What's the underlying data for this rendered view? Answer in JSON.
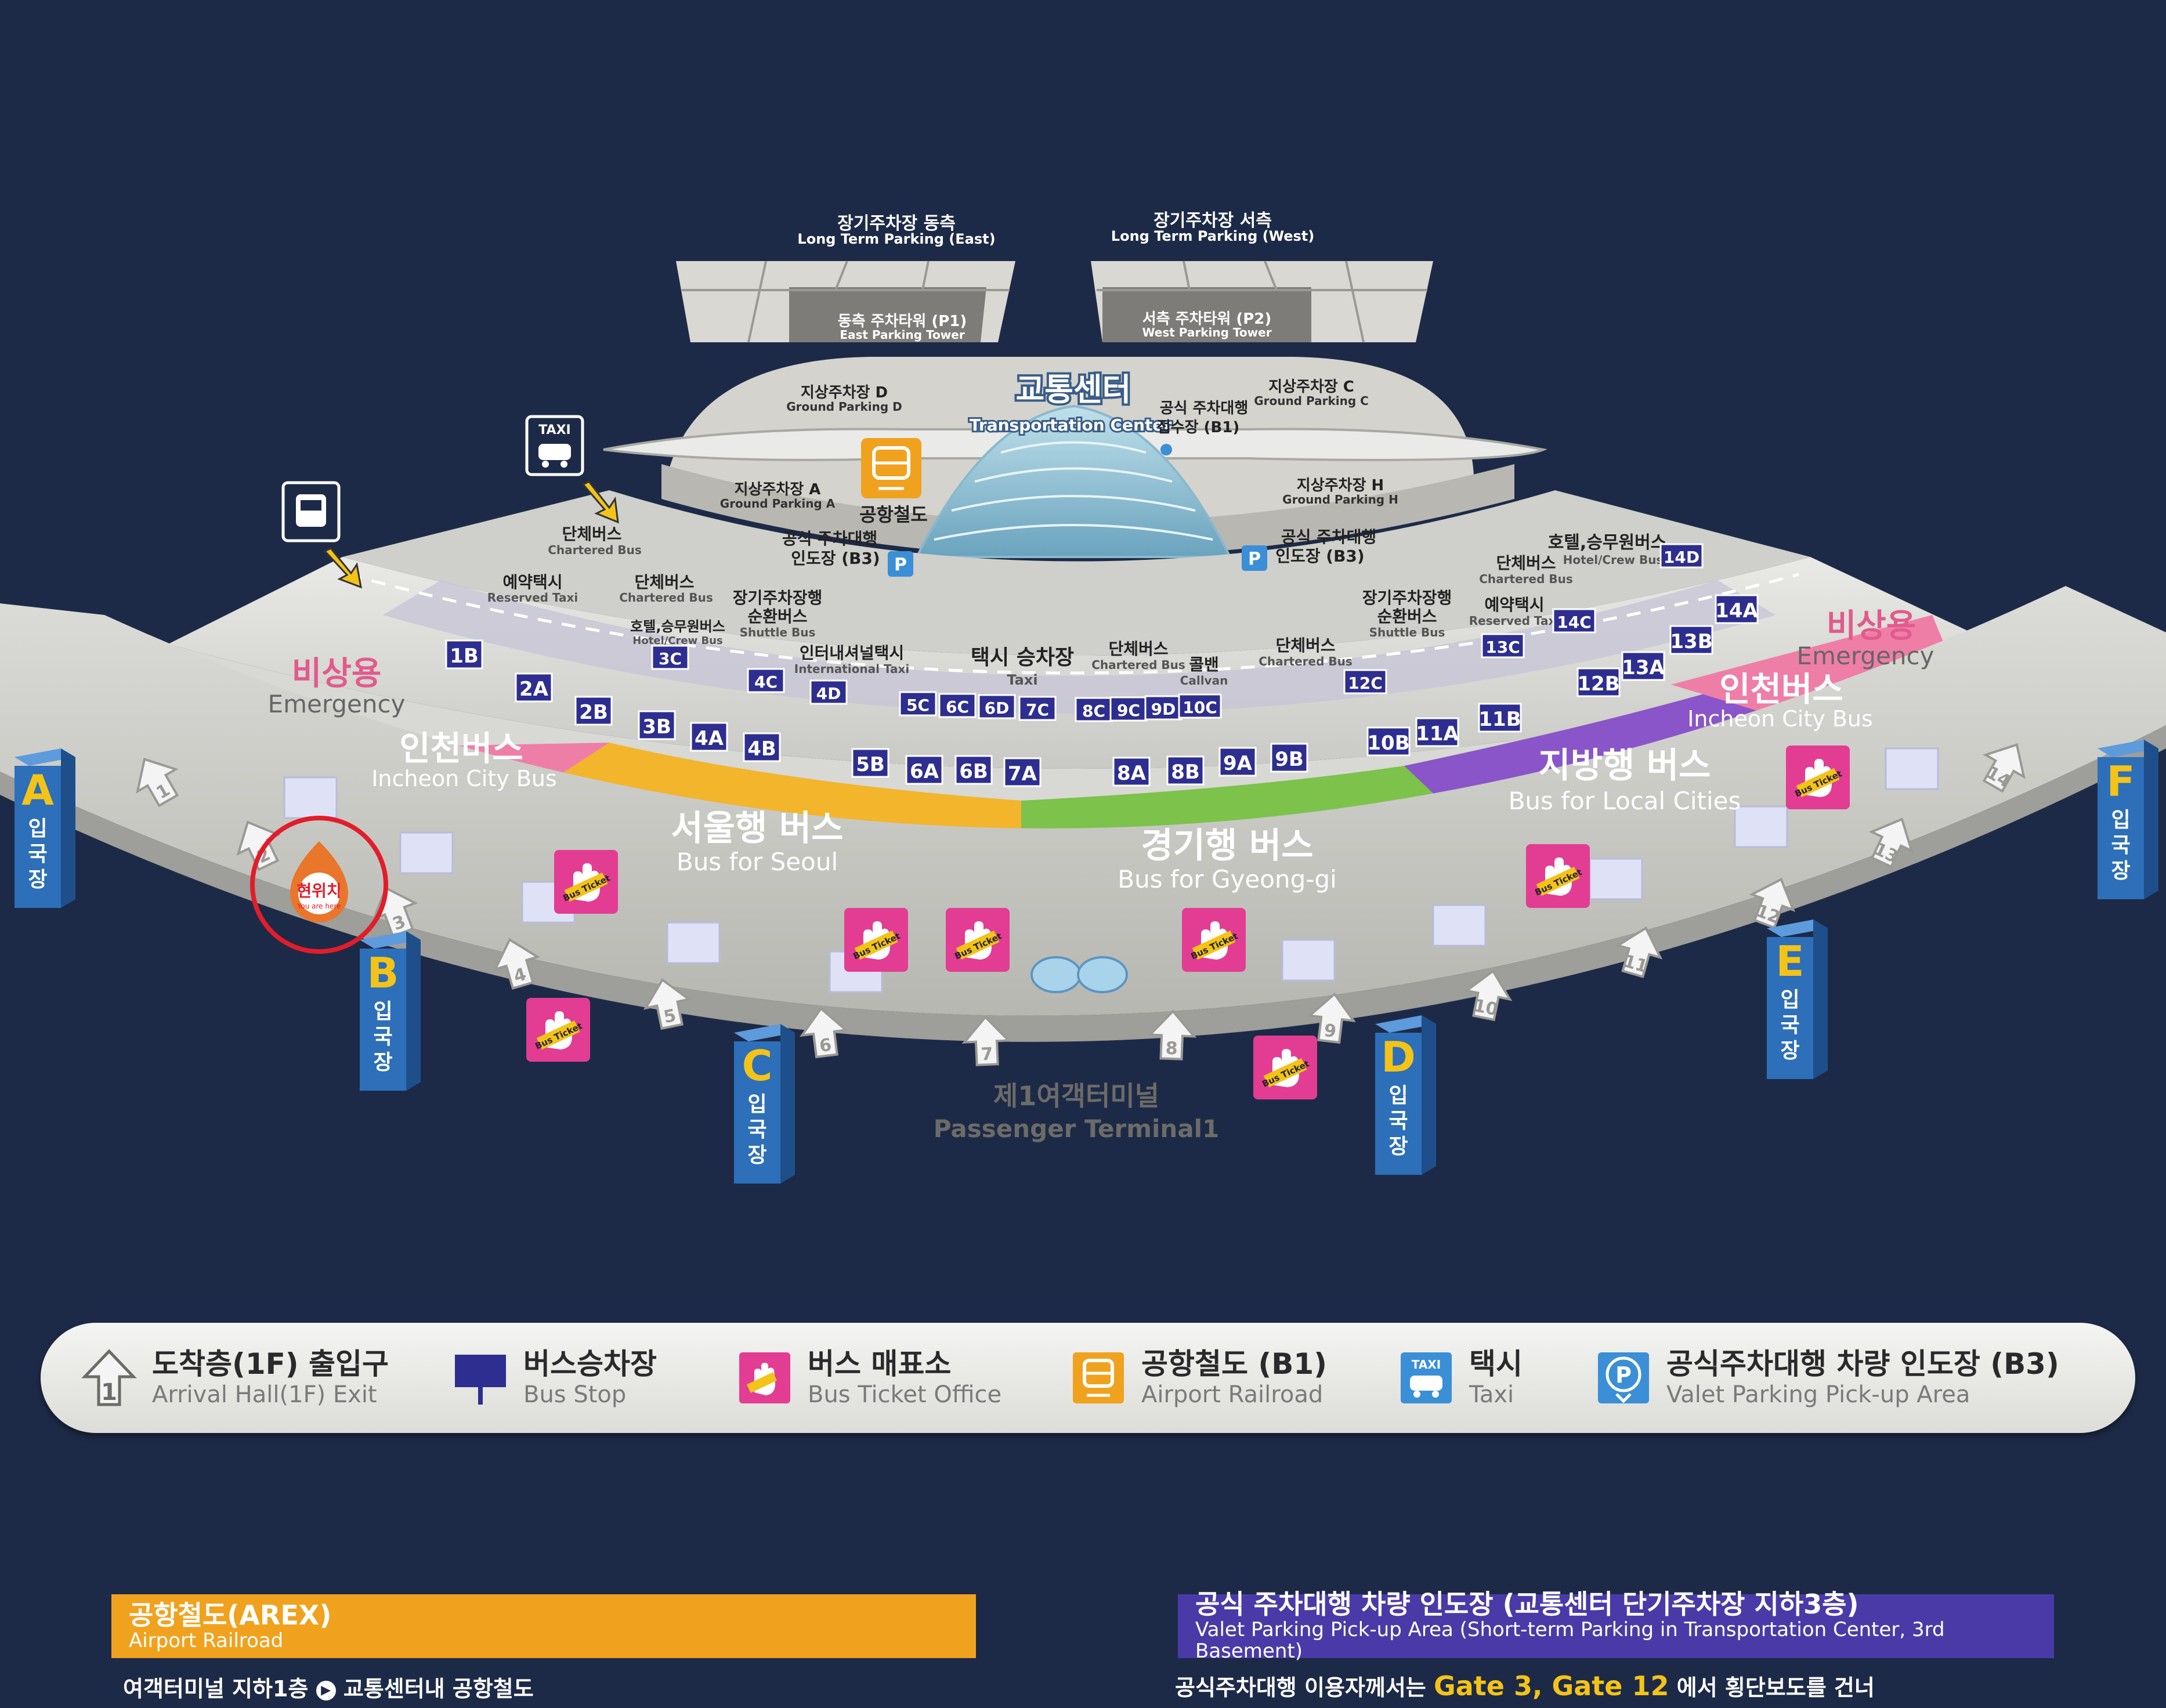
{
  "parking": {
    "east": {
      "ko": "장기주차장 동측",
      "en": "Long Term Parking (East)"
    },
    "west": {
      "ko": "장기주차장 서측",
      "en": "Long Term Parking (West)"
    },
    "east_tower": {
      "ko": "동측 주차타워 (P1)",
      "en": "East Parking Tower"
    },
    "west_tower": {
      "ko": "서측 주차타워 (P2)",
      "en": "West Parking Tower"
    },
    "ground_d": {
      "ko": "지상주차장 D",
      "en": "Ground Parking D"
    },
    "ground_c": {
      "ko": "지상주차장 C",
      "en": "Ground Parking C"
    },
    "ground_a": {
      "ko": "지상주차장 A",
      "en": "Ground Parking A"
    },
    "ground_h": {
      "ko": "지상주차장 H",
      "en": "Ground Parking H"
    }
  },
  "transport_center": {
    "ko": "교통센터",
    "en": "Transportation Center"
  },
  "valet_b1": {
    "line1": "공식 주차대행",
    "line2": "접수장 (B1)"
  },
  "valet_b3_left": {
    "line1": "공식 주차대행",
    "line2": "인도장 (B3)"
  },
  "valet_b3_right": {
    "line1": "공식 주차대행",
    "line2": "인도장 (B3)"
  },
  "railroad_label": "공항철도",
  "taxi_sign": "TAXI",
  "zones": {
    "chartered_left": {
      "ko": "단체버스",
      "en": "Chartered Bus"
    },
    "reserved_taxi_left": {
      "ko": "예약택시",
      "en": "Reserved Taxi"
    },
    "chartered_left2": {
      "ko": "단체버스",
      "en": "Chartered Bus"
    },
    "shuttle_left": {
      "ko1": "장기주차장행",
      "ko2": "순환버스",
      "en": "Shuttle Bus"
    },
    "hotel_left": {
      "ko": "호텔,승무원버스",
      "en": "Hotel/Crew Bus"
    },
    "intl_taxi": {
      "ko": "인터내셔널택시",
      "en": "International Taxi"
    },
    "taxi_stand": {
      "ko": "택시 승차장",
      "en": "Taxi"
    },
    "chartered_mid": {
      "ko": "단체버스",
      "en": "Chartered Bus"
    },
    "callvan": {
      "ko": "콜밴",
      "en": "Callvan"
    },
    "chartered_mid2": {
      "ko": "단체버스",
      "en": "Chartered Bus"
    },
    "shuttle_right": {
      "ko1": "장기주차장행",
      "ko2": "순환버스",
      "en": "Shuttle Bus"
    },
    "reserved_taxi_right": {
      "ko": "예약택시",
      "en": "Reserved Taxi"
    },
    "chartered_right": {
      "ko": "단체버스",
      "en": "Chartered Bus"
    },
    "hotel_right": {
      "ko": "호텔,승무원버스",
      "en": "Hotel/Crew Bus"
    }
  },
  "emergency_left": {
    "ko": "비상용",
    "en": "Emergency"
  },
  "emergency_right": {
    "ko": "비상용",
    "en": "Emergency"
  },
  "incheon_left": {
    "ko": "인천버스",
    "en": "Incheon City Bus"
  },
  "incheon_right": {
    "ko": "인천버스",
    "en": "Incheon City Bus"
  },
  "seoul": {
    "ko": "서울행 버스",
    "en": "Bus for Seoul"
  },
  "gyeonggi": {
    "ko": "경기행 버스",
    "en": "Bus for Gyeong-gi"
  },
  "local": {
    "ko": "지방행 버스",
    "en": "Bus for Local Cities"
  },
  "terminal": {
    "ko": "제1여객터미널",
    "en": "Passenger Terminal1"
  },
  "you_are_here": {
    "ko": "현위치",
    "en": "You are here"
  },
  "ticket_label": "Bus Ticket",
  "gate_suffix": "입국장",
  "gates": [
    "A",
    "B",
    "C",
    "D",
    "E",
    "F"
  ],
  "bus_stops": [
    "1B",
    "2A",
    "2B",
    "3B",
    "4A",
    "4B",
    "3C",
    "4C",
    "4D",
    "5C",
    "6C",
    "6D",
    "7C",
    "8C",
    "9C",
    "9D",
    "10C",
    "5B",
    "6A",
    "6B",
    "7A",
    "8A",
    "8B",
    "9A",
    "9B",
    "10B",
    "11A",
    "11B",
    "12C",
    "12B",
    "13A",
    "13B",
    "13C",
    "14C",
    "14A",
    "14D"
  ],
  "exits": [
    "1",
    "2",
    "3",
    "4",
    "5",
    "6",
    "7",
    "8",
    "9",
    "10",
    "11",
    "12",
    "13",
    "14"
  ],
  "legend": [
    {
      "ko": "도착층(1F) 출입구",
      "en": "Arrival Hall(1F) Exit",
      "icon": "arrow-up-1-icon"
    },
    {
      "ko": "버스승차장",
      "en": "Bus Stop",
      "icon": "bus-stop-sign-icon"
    },
    {
      "ko": "버스 매표소",
      "en": "Bus Ticket Office",
      "icon": "bus-ticket-hand-icon"
    },
    {
      "ko": "공항철도 (B1)",
      "en": "Airport Railroad",
      "icon": "train-icon"
    },
    {
      "ko": "택시",
      "en": "Taxi",
      "icon": "taxi-icon"
    },
    {
      "ko": "공식주차대행 차량 인도장 (B3)",
      "en": "Valet Parking Pick-up Area",
      "icon": "valet-parking-icon"
    }
  ],
  "arex": {
    "ko": "공항철도(AREX)",
    "en": "Airport Railroad",
    "desc_a": "여객터미널 지하1층",
    "desc_b": "교통센터내 공항철도"
  },
  "valet_info": {
    "ko": "공식 주차대행 차량 인도장 (교통센터 단기주차장 지하3층)",
    "en": "Valet Parking Pick-up Area (Short-term Parking in Transportation Center, 3rd Basement)",
    "text_a": "공식주차대행 이용자께서는",
    "gates": "Gate 3, Gate 12",
    "text_b": "에서 횡단보도를 건너"
  },
  "colors": {
    "bg": "#1d2a47",
    "seoul": "#f2b52c",
    "gyeonggi": "#7cc24b",
    "local": "#8a55c8",
    "incheon": "#ef7ea7",
    "stop": "#2d2e8f",
    "ticket": "#e23d93",
    "gate": "#2d6fb8",
    "gate_letter": "#f3c318",
    "arex": "#f0a21e",
    "valet": "#4a3aa8"
  }
}
